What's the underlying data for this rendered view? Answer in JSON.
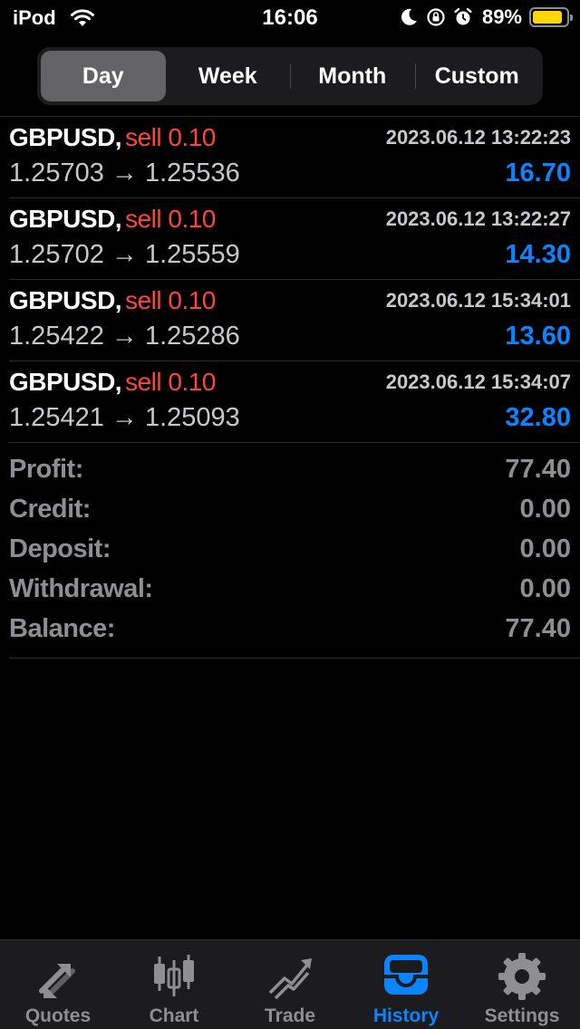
{
  "status": {
    "carrier": "iPod",
    "time": "16:06",
    "battery_percent": "89%",
    "battery_level": 0.89,
    "battery_color": "#ffd60a",
    "icons": [
      "wifi-icon",
      "moon-icon",
      "orientation-lock-icon",
      "alarm-icon",
      "battery-icon"
    ]
  },
  "periods": {
    "tabs": [
      "Day",
      "Week",
      "Month",
      "Custom"
    ],
    "selected": "Day"
  },
  "deals": [
    {
      "symbol": "GBPUSD",
      "side": "sell",
      "volume": "0.10",
      "datetime": "2023.06.12 13:22:23",
      "open_price": "1.25703",
      "close_price": "1.25536",
      "profit": "16.70"
    },
    {
      "symbol": "GBPUSD",
      "side": "sell",
      "volume": "0.10",
      "datetime": "2023.06.12 13:22:27",
      "open_price": "1.25702",
      "close_price": "1.25559",
      "profit": "14.30"
    },
    {
      "symbol": "GBPUSD",
      "side": "sell",
      "volume": "0.10",
      "datetime": "2023.06.12 15:34:01",
      "open_price": "1.25422",
      "close_price": "1.25286",
      "profit": "13.60"
    },
    {
      "symbol": "GBPUSD",
      "side": "sell",
      "volume": "0.10",
      "datetime": "2023.06.12 15:34:07",
      "open_price": "1.25421",
      "close_price": "1.25093",
      "profit": "32.80"
    }
  ],
  "summary": {
    "profit_label": "Profit:",
    "profit": "77.40",
    "credit_label": "Credit:",
    "credit": "0.00",
    "deposit_label": "Deposit:",
    "deposit": "0.00",
    "withdrawal_label": "Withdrawal:",
    "withdrawal": "0.00",
    "balance_label": "Balance:",
    "balance": "77.40"
  },
  "tabbar": {
    "items": [
      {
        "label": "Quotes",
        "icon": "quotes-icon"
      },
      {
        "label": "Chart",
        "icon": "candlestick-chart-icon"
      },
      {
        "label": "Trade",
        "icon": "trade-icon"
      },
      {
        "label": "History",
        "icon": "history-inbox-icon"
      },
      {
        "label": "Settings",
        "icon": "gear-icon"
      }
    ],
    "selected": "History"
  },
  "colors": {
    "sell": "#ff453a",
    "profit": "#0a84ff",
    "active_tab": "#0a84ff",
    "inactive_tab": "#8e8e93"
  }
}
